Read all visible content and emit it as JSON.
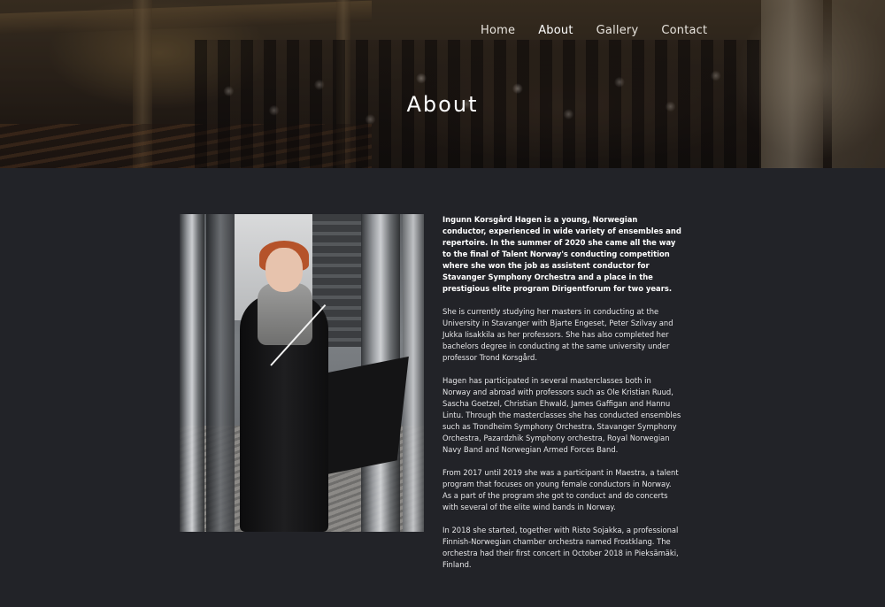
{
  "nav": {
    "items": [
      {
        "label": "Home"
      },
      {
        "label": "About"
      },
      {
        "label": "Gallery"
      },
      {
        "label": "Contact"
      }
    ],
    "active": "About"
  },
  "hero": {
    "title": "About"
  },
  "bio": {
    "paragraphs": [
      "Ingunn Korsgård Hagen is a young, Norwegian conductor, experienced in wide variety of ensembles and repertoire. In the summer of 2020 she came all the way to the final of Talent Norway's conducting competition where she won the job as assistent conductor for Stavanger Symphony Orchestra and a place in the prestigious elite program Dirigentforum for two years.",
      "She is currently studying her masters in conducting at the University in Stavanger with Bjarte Engeset, Peter Szilvay and Jukka Iisakkila as her professors. She has also completed her bachelors degree in conducting at the same university under professor Trond Korsgård.",
      "Hagen has participated in several masterclasses both in Norway and abroad with professors such as Ole Kristian Ruud, Sascha Goetzel, Christian Ehwald, James Gaffigan and Hannu Lintu. Through the masterclasses she has conducted ensembles such as Trondheim Symphony Orchestra, Stavanger Symphony Orchestra, Pazardzhik Symphony orchestra, Royal Norwegian Navy Band and Norwegian Armed Forces Band.",
      "From 2017 until 2019 she was a participant in Maestra, a talent program that focuses on young female conductors in Norway. As a part of the program she got to conduct and do concerts with several of the elite wind bands in Norway.",
      "In 2018 she started, together with Risto Sojakka, a professional Finnish-Norwegian chamber orchestra named Frostklang. The orchestra had their first concert in October 2018 in Pieksämäki, Finland."
    ]
  },
  "colors": {
    "background": "#222328",
    "text": "#e6e6e8",
    "heading": "#ffffff"
  }
}
